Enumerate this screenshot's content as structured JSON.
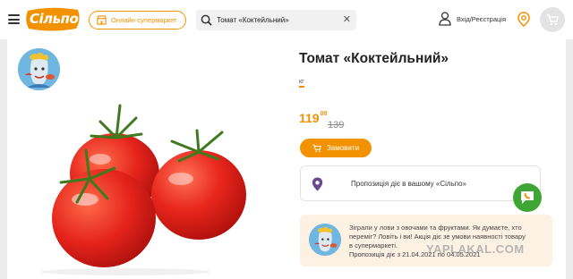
{
  "header": {
    "logo_text": "Сільпо",
    "market_button": "Онлайн-супермаркет",
    "search_value": "Томат «Коктейльний»",
    "user_label": "Вхід/Реєстрація"
  },
  "product": {
    "title": "Томат «Коктейльний»",
    "unit": "кг",
    "price_main": "119",
    "price_cents": "00",
    "price_old": "139",
    "order_button": "Замовити"
  },
  "offer": {
    "label": "Пропозиція діє в вашому «Сільпо»"
  },
  "promo": {
    "line1": "Зіграли у лови з овочами та фруктами. Як думаєте, хто",
    "line2": "переміг? Ловіть і ви! Акція діє зе умови наявності товару",
    "line3": "в супермаркеті.",
    "line4": "Пропозиція діє з 21.04.2021 по 04.05.2021"
  },
  "watermark": "YAPLAKAL.COM",
  "colors": {
    "accent": "#f39200",
    "chat": "#3fa535",
    "promo_bg": "#fdf1e4"
  },
  "icons": [
    "menu-icon",
    "shop-icon",
    "search-icon",
    "close-icon",
    "user-icon",
    "location-icon",
    "cart-icon",
    "chat-icon"
  ]
}
